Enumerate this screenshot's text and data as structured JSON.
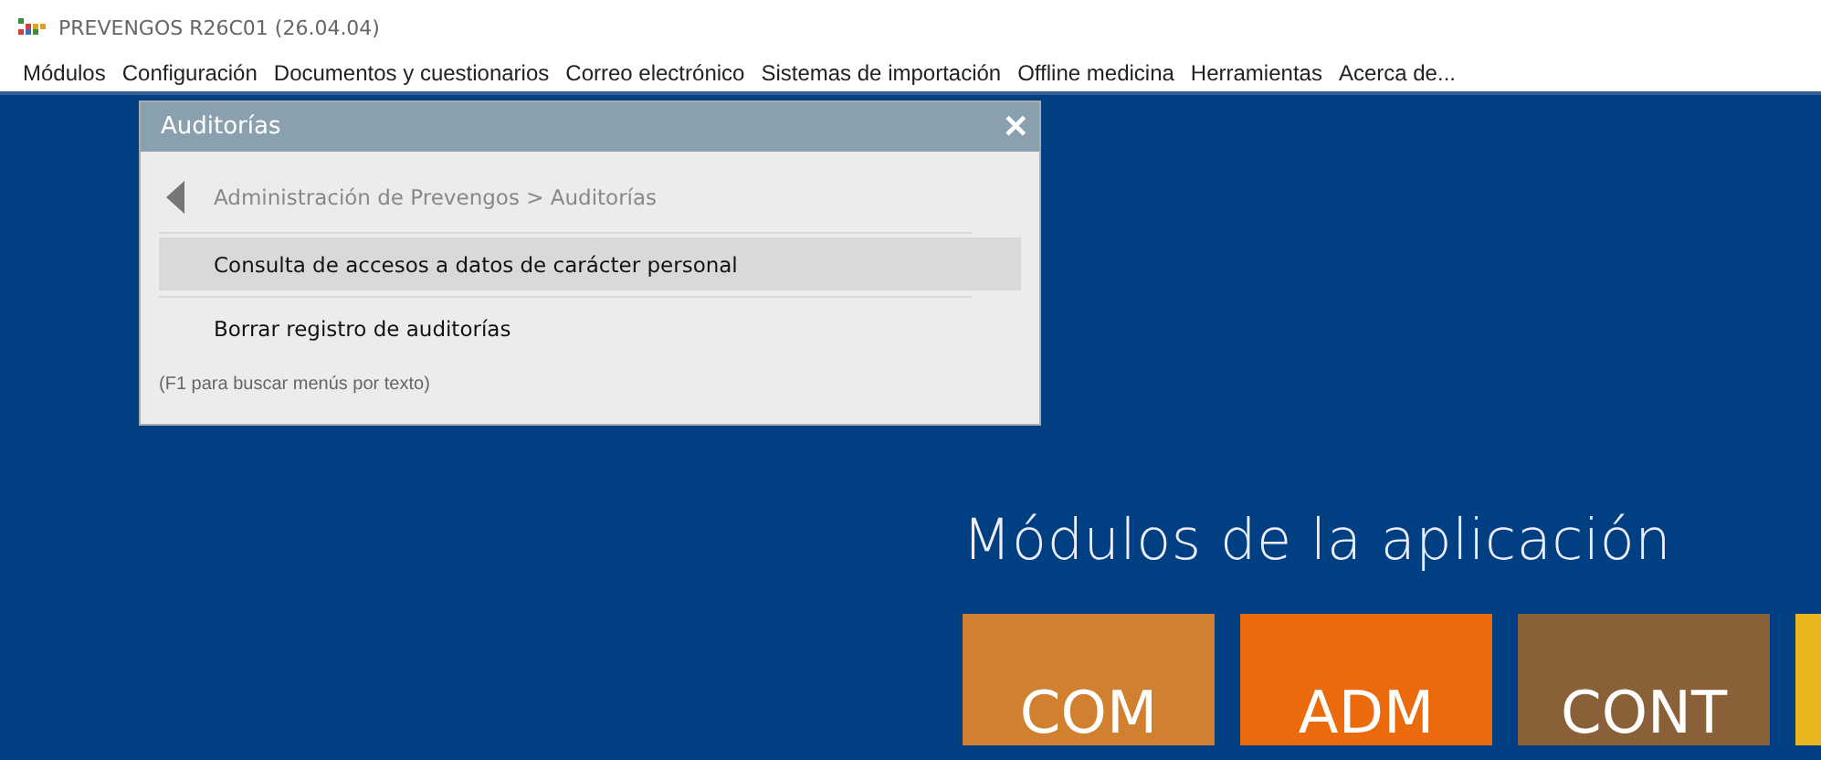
{
  "window": {
    "title": "PREVENGOS R26C01 (26.04.04)"
  },
  "menu": [
    "Módulos",
    "Configuración",
    "Documentos y cuestionarios",
    "Correo electrónico",
    "Sistemas de importación",
    "Offline medicina",
    "Herramientas",
    "Acerca de..."
  ],
  "popup": {
    "title": "Auditorías",
    "close": "✕",
    "breadcrumb": "Administración de Prevengos > Auditorías",
    "items": [
      {
        "label": "Consulta de accesos a datos de carácter personal",
        "selected": true
      },
      {
        "label": "Borrar registro de auditorías",
        "selected": false
      }
    ],
    "hint": "(F1 para buscar menús por texto)"
  },
  "modules": {
    "title": "Módulos de la aplicación",
    "tiles": [
      {
        "label": "COM",
        "color": "#d0802f"
      },
      {
        "label": "ADM",
        "color": "#eb6a0b"
      },
      {
        "label": "CONT",
        "color": "#8a6038"
      },
      {
        "color": "#ebb520"
      }
    ]
  }
}
